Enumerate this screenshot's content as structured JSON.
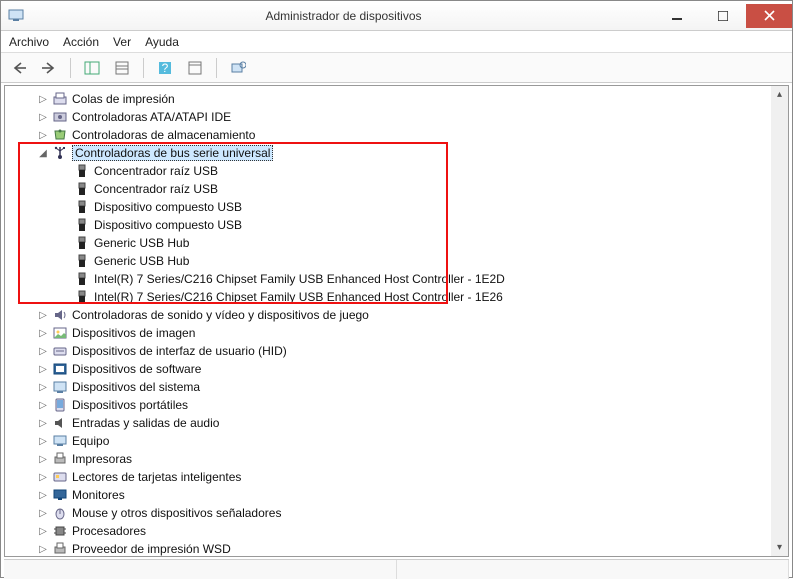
{
  "window": {
    "title": "Administrador de dispositivos"
  },
  "menu": {
    "file": "Archivo",
    "action": "Acción",
    "view": "Ver",
    "help": "Ayuda"
  },
  "tree": {
    "items": [
      {
        "indent": 1,
        "exp": "▷",
        "icon": "queue",
        "label": "Colas de impresión"
      },
      {
        "indent": 1,
        "exp": "▷",
        "icon": "controller",
        "label": "Controladoras ATA/ATAPI IDE"
      },
      {
        "indent": 1,
        "exp": "▷",
        "icon": "storage",
        "label": "Controladoras de almacenamiento"
      },
      {
        "indent": 1,
        "exp": "◢",
        "icon": "usb",
        "label": "Controladoras de bus serie universal",
        "selected": true
      },
      {
        "indent": 2,
        "exp": "",
        "icon": "usbdev",
        "label": "Concentrador raíz USB"
      },
      {
        "indent": 2,
        "exp": "",
        "icon": "usbdev",
        "label": "Concentrador raíz USB"
      },
      {
        "indent": 2,
        "exp": "",
        "icon": "usbdev",
        "label": "Dispositivo compuesto USB"
      },
      {
        "indent": 2,
        "exp": "",
        "icon": "usbdev",
        "label": "Dispositivo compuesto USB"
      },
      {
        "indent": 2,
        "exp": "",
        "icon": "usbdev",
        "label": "Generic USB Hub"
      },
      {
        "indent": 2,
        "exp": "",
        "icon": "usbdev",
        "label": "Generic USB Hub"
      },
      {
        "indent": 2,
        "exp": "",
        "icon": "usbdev",
        "label": "Intel(R) 7 Series/C216 Chipset Family USB Enhanced Host Controller - 1E2D"
      },
      {
        "indent": 2,
        "exp": "",
        "icon": "usbdev",
        "label": "Intel(R) 7 Series/C216 Chipset Family USB Enhanced Host Controller - 1E26"
      },
      {
        "indent": 1,
        "exp": "▷",
        "icon": "sound",
        "label": "Controladoras de sonido y vídeo y dispositivos de juego"
      },
      {
        "indent": 1,
        "exp": "▷",
        "icon": "image",
        "label": "Dispositivos de imagen"
      },
      {
        "indent": 1,
        "exp": "▷",
        "icon": "hid",
        "label": "Dispositivos de interfaz de usuario (HID)"
      },
      {
        "indent": 1,
        "exp": "▷",
        "icon": "software",
        "label": "Dispositivos de software"
      },
      {
        "indent": 1,
        "exp": "▷",
        "icon": "system",
        "label": "Dispositivos del sistema"
      },
      {
        "indent": 1,
        "exp": "▷",
        "icon": "portable",
        "label": "Dispositivos portátiles"
      },
      {
        "indent": 1,
        "exp": "▷",
        "icon": "audio",
        "label": "Entradas y salidas de audio"
      },
      {
        "indent": 1,
        "exp": "▷",
        "icon": "computer",
        "label": "Equipo"
      },
      {
        "indent": 1,
        "exp": "▷",
        "icon": "printer",
        "label": "Impresoras"
      },
      {
        "indent": 1,
        "exp": "▷",
        "icon": "smartcard",
        "label": "Lectores de tarjetas inteligentes"
      },
      {
        "indent": 1,
        "exp": "▷",
        "icon": "monitor",
        "label": "Monitores"
      },
      {
        "indent": 1,
        "exp": "▷",
        "icon": "mouse",
        "label": "Mouse y otros dispositivos señaladores"
      },
      {
        "indent": 1,
        "exp": "▷",
        "icon": "cpu",
        "label": "Procesadores"
      },
      {
        "indent": 1,
        "exp": "▷",
        "icon": "printprov",
        "label": "Proveedor de impresión WSD"
      }
    ]
  }
}
